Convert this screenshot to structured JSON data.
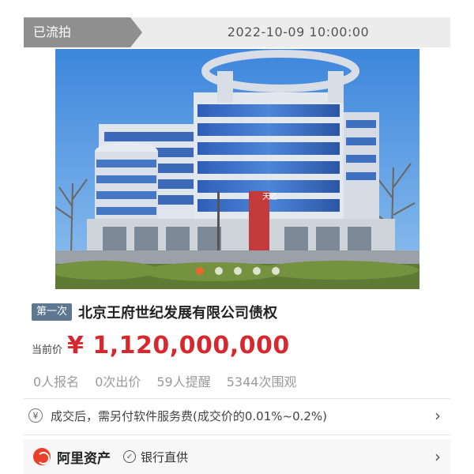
{
  "status": {
    "tag": "已流拍",
    "time": "2022-10-09 10:00:00"
  },
  "gallery": {
    "slide_count": 5,
    "active_index": 0,
    "accent_color": "#e9682a",
    "sign_text": "天乙"
  },
  "item": {
    "round_badge": "第一次",
    "title": "北京王府世纪发展有限公司债权"
  },
  "price": {
    "label": "当前价",
    "value": "¥ 1,120,000,000",
    "color": "#d6282f"
  },
  "stats": [
    {
      "text": "0人报名"
    },
    {
      "text": "0次出价"
    },
    {
      "text": "59人提醒"
    },
    {
      "text": "5344次围观"
    }
  ],
  "fee": {
    "icon_glyph": "¥",
    "text": "成交后，需另付软件服务费(成交价的0.01%~0.2%)",
    "chevron": "›"
  },
  "footer": {
    "platform": "阿里资产",
    "check_glyph": "✓",
    "bank_text": "银行直供",
    "chevron": "›",
    "brand_color": "#e8402b"
  }
}
